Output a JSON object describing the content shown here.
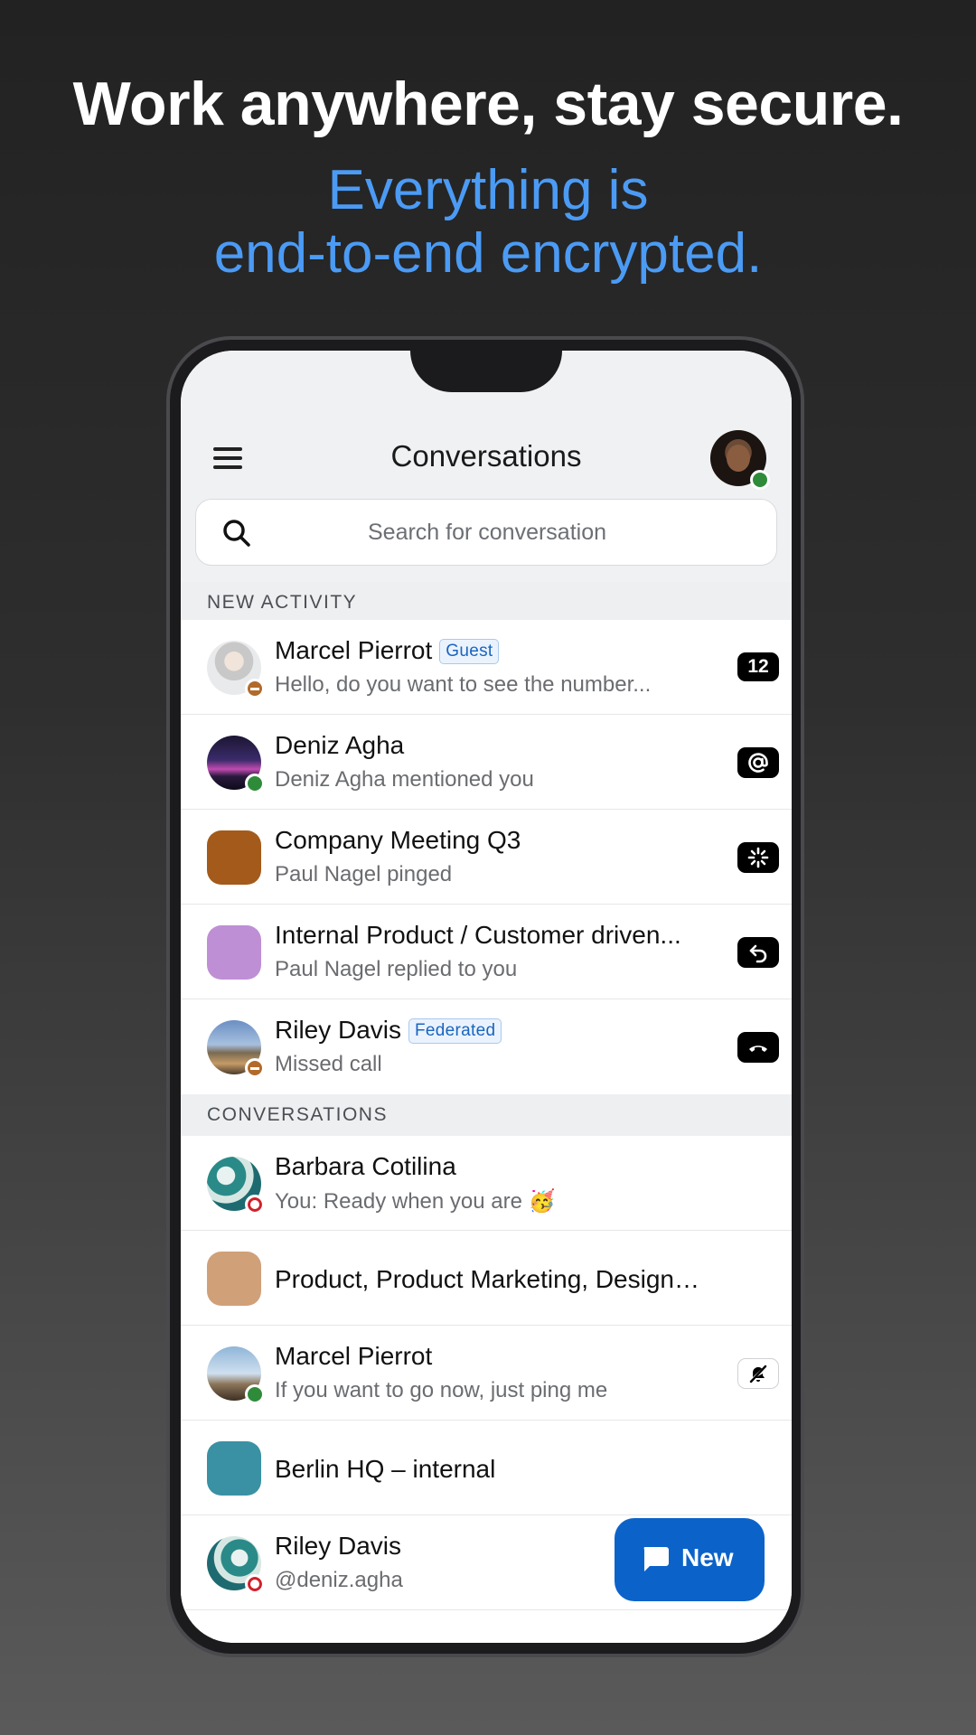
{
  "promo": {
    "headline": "Work anywhere, stay secure.",
    "sub_line1": "Everything is",
    "sub_line2": "end-to-end encrypted."
  },
  "header": {
    "title": "Conversations",
    "menu_icon": "hamburger-menu-icon",
    "user_status": "online"
  },
  "search": {
    "placeholder": "Search for conversation"
  },
  "sections": {
    "new_activity": "NEW ACTIVITY",
    "conversations": "CONVERSATIONS"
  },
  "new_activity": [
    {
      "name": "Marcel Pierrot",
      "tag": "Guest",
      "preview": "Hello, do you want to see the number...",
      "badge": "12",
      "status": "dnd"
    },
    {
      "name": "Deniz Agha",
      "preview": "Deniz Agha mentioned you",
      "indicator": "at-mention-icon",
      "status": "online"
    },
    {
      "name": "Company Meeting Q3",
      "preview": "Paul Nagel pinged",
      "indicator": "ping-icon",
      "color": "#a45a1a"
    },
    {
      "name": "Internal Product / Customer driven...",
      "preview": "Paul Nagel replied to you",
      "indicator": "reply-icon",
      "color": "#bf8fd5"
    },
    {
      "name": "Riley Davis",
      "tag": "Federated",
      "preview": "Missed call",
      "indicator": "missed-call-icon",
      "status": "dnd"
    }
  ],
  "conversations": [
    {
      "name": "Barbara Cotilina",
      "preview": "You: Ready when you are 🥳",
      "status": "busy"
    },
    {
      "name": "Product, Product Marketing, Design…",
      "color": "#d0a079"
    },
    {
      "name": "Marcel Pierrot",
      "preview": "If you want to go now, just ping me",
      "indicator": "muted-bell-icon",
      "status": "online"
    },
    {
      "name": "Berlin HQ – internal",
      "color": "#3a91a3"
    },
    {
      "name": "Riley Davis",
      "preview": "@deniz.agha",
      "status": "busy"
    }
  ],
  "fab": {
    "label": "New"
  }
}
